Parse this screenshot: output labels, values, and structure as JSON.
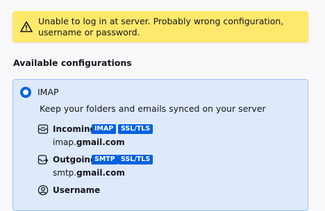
{
  "warning": {
    "icon": "warning-triangle-icon",
    "message": "Unable to log in at server. Probably wrong configuration, username or password."
  },
  "section": {
    "title": "Available configurations"
  },
  "configuration": {
    "name": "IMAP",
    "selected": true,
    "description": "Keep your folders and emails synced on your server",
    "incoming": {
      "label": "Incoming",
      "icon": "inbox-icon",
      "protocol": "IMAP",
      "security": "SSL/TLS",
      "host_prefix": "imap.",
      "host_domain": "gmail.com"
    },
    "outgoing": {
      "label": "Outgoing",
      "icon": "outbox-icon",
      "protocol": "SMTP",
      "security": "SSL/TLS",
      "host_prefix": "smtp.",
      "host_domain": "gmail.com"
    },
    "username": {
      "label": "Username",
      "icon": "user-icon"
    }
  },
  "colors": {
    "warning_bg": "#ffe96c",
    "card_bg": "#deeafc",
    "card_border": "#9cc0f1",
    "accent": "#0061e0"
  }
}
